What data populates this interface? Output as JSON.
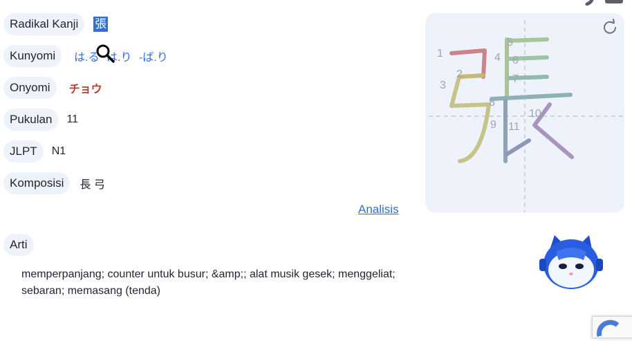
{
  "rows": {
    "radical": {
      "label": "Radikal Kanji",
      "value": "張"
    },
    "kunyomi": {
      "label": "Kunyomi",
      "values": [
        "は.る",
        "は.り",
        "-ば.り"
      ]
    },
    "onyomi": {
      "label": "Onyomi",
      "value": "チョウ"
    },
    "strokes": {
      "label": "Pukulan",
      "value": "11"
    },
    "jlpt": {
      "label": "JLPT",
      "value": "N1"
    },
    "composition": {
      "label": "Komposisi",
      "value": "長 弓"
    }
  },
  "analysis_link": "Analisis",
  "meaning": {
    "label": "Arti",
    "text": "memperpanjang; counter untuk busur; &amp;; alat musik gesek; menggeliat; sebaran; memasang (tenda)"
  },
  "stroke_diagram": {
    "numbers": [
      "1",
      "2",
      "3",
      "4",
      "5",
      "6",
      "7",
      "8",
      "9",
      "10",
      "11"
    ]
  },
  "colors": {
    "accent": "#2f6fd6",
    "onyomi": "#c0392b",
    "pill_bg": "#eef2fb"
  },
  "icons": [
    "search-icon",
    "refresh-icon",
    "mascot-icon",
    "recaptcha-icon"
  ]
}
